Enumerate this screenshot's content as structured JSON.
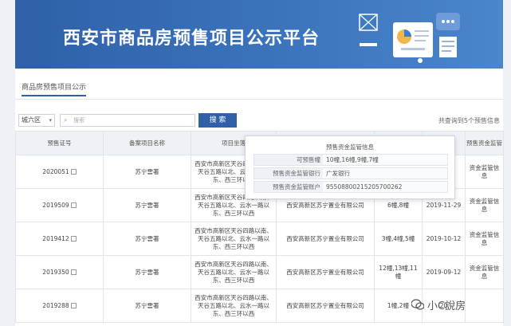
{
  "header": {
    "title": "西安市商品房预售项目公示平台"
  },
  "tabs": [
    {
      "label": "商品房预售项目公示"
    }
  ],
  "filter": {
    "district_value": "城六区",
    "search_placeholder": "搜索",
    "search_button": "搜 索",
    "total_text": "共查询到5个预售信息"
  },
  "table": {
    "columns": [
      "预售证号",
      "备案项目名称",
      "项目坐落",
      "开发企业",
      "预售楼栋",
      "发证日期",
      "预售资金监管"
    ],
    "rows": [
      {
        "cert": "2020051",
        "project": "苏宁雲著",
        "address": "西安市高新区天谷四路以南、天谷五路以北、云水一路以东、西三环以西",
        "company": "",
        "buildings": "",
        "date": "",
        "action": "资金监管信息",
        "action_highlight": true
      },
      {
        "cert": "2019509",
        "project": "苏宁雲著",
        "address": "西安市高新区天谷四路以南、天谷五路以北、云水一路以东、西三环以西",
        "company": "西安高新区苏宁置业有限公司",
        "buildings": "6幢,8幢",
        "date": "2019-11-29",
        "action": "资金监管信息",
        "action_highlight": false
      },
      {
        "cert": "2019412",
        "project": "苏宁雲著",
        "address": "西安市高新区天谷四路以南、天谷五路以北、云水一路以东、西三环以西",
        "company": "西安高新区苏宁置业有限公司",
        "buildings": "3幢,4幢,5幢",
        "date": "2019-10-12",
        "action": "资金监管信息",
        "action_highlight": false
      },
      {
        "cert": "2019350",
        "project": "苏宁雲著",
        "address": "西安市高新区天谷四路以南、天谷五路以北、云水一路以东、西三环以西",
        "company": "西安高新区苏宁置业有限公司",
        "buildings": "12幢,13幢,11幢",
        "date": "2019-09-12",
        "action": "资金监管信息",
        "action_highlight": false
      },
      {
        "cert": "2019288",
        "project": "苏宁雲著",
        "address": "西安市高新区天谷四路以南、天谷五路以北、云水一路以东、西三环以西",
        "company": "西安高新区苏宁置业有限公司",
        "buildings": "1幢,2幢",
        "date": "20",
        "action": "",
        "action_highlight": false
      }
    ]
  },
  "popup": {
    "title": "预售资金监管信息",
    "rows": [
      {
        "label": "可预售幢",
        "value": "10幢,16幢,9幢,7幢"
      },
      {
        "label": "预售资金监管银行",
        "value": "广发银行"
      },
      {
        "label": "预售资金监管账户",
        "value": "9550880021520570026​2"
      }
    ]
  },
  "watermark": {
    "text": "小C說房"
  },
  "colors": {
    "banner": "#2f60a8",
    "accent": "#2f60a8",
    "highlight": "#e8a14a"
  }
}
